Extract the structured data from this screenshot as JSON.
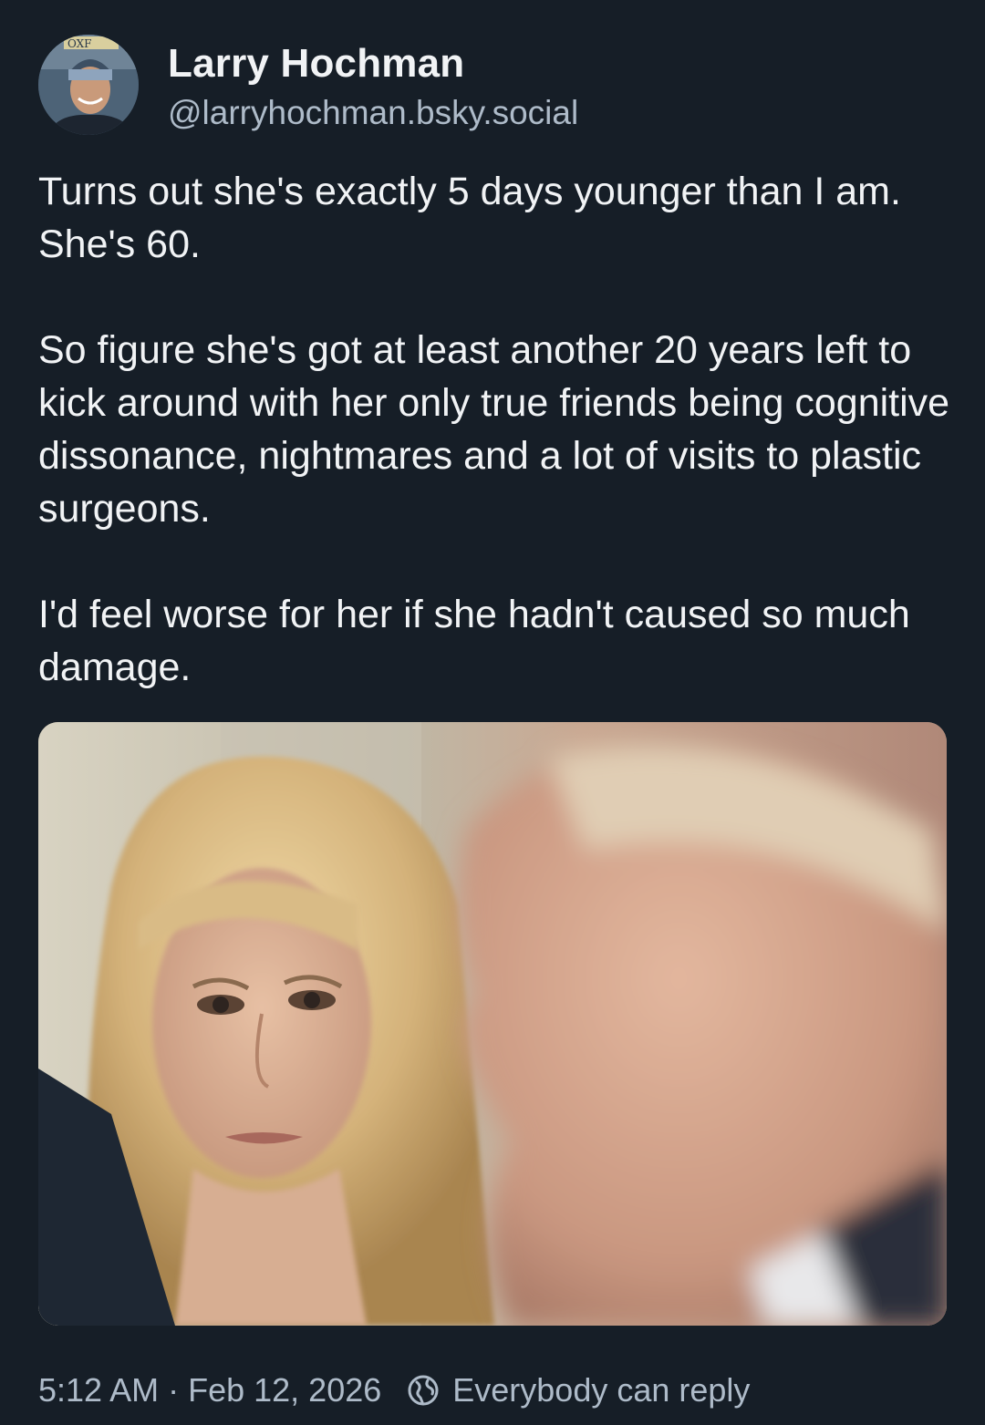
{
  "author": {
    "display_name": "Larry Hochman",
    "handle": "@larryhochman.bsky.social",
    "avatar_icon": "avatar-photo"
  },
  "post": {
    "paragraphs": [
      "Turns out she's exactly 5 days younger than I am. She's 60.",
      "So figure she's got at least another 20 years left to kick around with her only true friends being cognitive dissonance, nightmares and a lot of visits to plastic surgeons.",
      "I'd feel worse for her if she hadn't caused so much damage."
    ],
    "image_icon": "post-photo"
  },
  "meta": {
    "time": "5:12 AM",
    "separator": "·",
    "date": "Feb 12, 2026",
    "reply_icon": "globe-icon",
    "reply_setting": "Everybody can reply"
  },
  "colors": {
    "background": "#161e27",
    "text": "#f1f3f5",
    "muted": "#aebbc9"
  }
}
